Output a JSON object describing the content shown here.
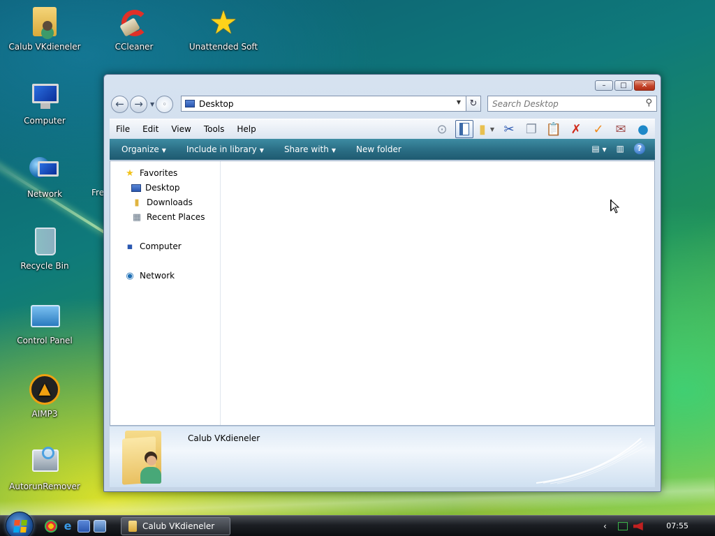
{
  "desktop": {
    "icons": [
      {
        "label": "Calub VKdieneler",
        "icon": "user-folder-icon"
      },
      {
        "label": "CCleaner",
        "icon": "ccleaner-icon"
      },
      {
        "label": "Unattended Soft",
        "icon": "star-icon"
      },
      {
        "label": "Computer",
        "icon": "computer-icon"
      },
      {
        "label": "Network",
        "icon": "network-icon"
      },
      {
        "label": "Recycle Bin",
        "icon": "recycle-bin-icon"
      },
      {
        "label": "Control Panel",
        "icon": "control-panel-icon"
      },
      {
        "label": "AIMP3",
        "icon": "aimp-icon"
      },
      {
        "label": "AutorunRemover",
        "icon": "autorun-remover-icon"
      }
    ],
    "partial_label": "Fre"
  },
  "window": {
    "controls": {
      "minimize": "–",
      "maximize": "□",
      "close": "✕"
    },
    "nav": {
      "back": "←",
      "forward": "→"
    },
    "address": {
      "value": "Desktop"
    },
    "search": {
      "placeholder": "Search Desktop"
    },
    "menu": [
      "File",
      "Edit",
      "View",
      "Tools",
      "Help"
    ],
    "commands": [
      "Organize",
      "Include in library",
      "Share with",
      "New folder"
    ],
    "navpane": {
      "favorites": "Favorites",
      "desktop": "Desktop",
      "downloads": "Downloads",
      "recent_places": "Recent Places",
      "computer": "Computer",
      "network": "Network"
    },
    "details": {
      "name": "Calub VKdieneler"
    }
  },
  "taskbar": {
    "task_label": "Calub VKdieneler",
    "clock": "07:55"
  },
  "colors": {
    "command_bar": "#2b6f86",
    "window_frame": "#c4d4e6"
  }
}
